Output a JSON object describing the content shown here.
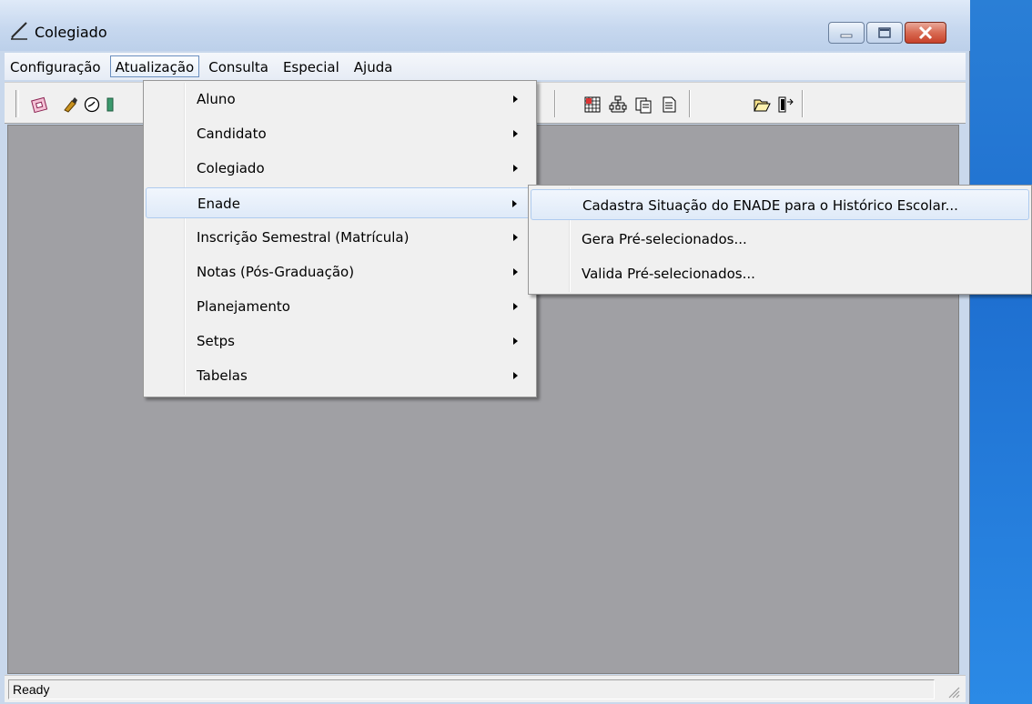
{
  "window": {
    "title": "Colegiado",
    "icon": "pencil-icon"
  },
  "menubar": {
    "items": [
      "Configuração",
      "Atualização",
      "Consulta",
      "Especial",
      "Ajuda"
    ],
    "active": "Atualização"
  },
  "atualizacao_menu": {
    "items": [
      "Aluno",
      "Candidato",
      "Colegiado",
      "Enade",
      "Inscrição Semestral (Matrícula)",
      "Notas (Pós-Graduação)",
      "Planejamento",
      "Setps",
      "Tabelas"
    ],
    "highlighted": "Enade"
  },
  "enade_submenu": {
    "items": [
      "Cadastra Situação do ENADE para o Histórico Escolar...",
      "Gera Pré-selecionados...",
      "Valida Pré-selecionados..."
    ],
    "highlighted": "Cadastra Situação do ENADE para o Histórico Escolar..."
  },
  "toolbar": {
    "icons": [
      "calendar-icon",
      "brush-icon",
      "clock-icon",
      "document-icon",
      "grid-icon",
      "hierarchy-icon",
      "copy-icon",
      "page-icon",
      "open-folder-icon",
      "exit-door-icon"
    ]
  },
  "statusbar": {
    "text": "Ready"
  },
  "colors": {
    "menu_highlight": "#dfeaf8",
    "client_background": "#a0a0a4",
    "desktop": "#1e6fd0"
  }
}
